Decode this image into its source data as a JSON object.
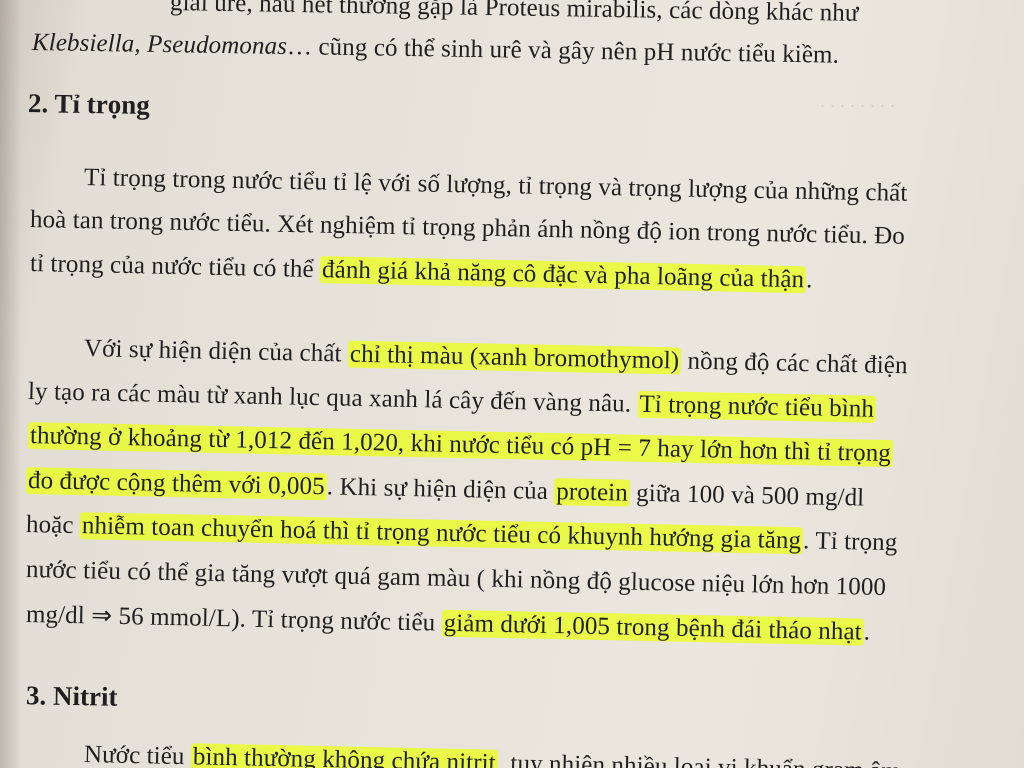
{
  "page": {
    "intro_line1": "giải urê, hầu hết thường gặp là Proteus mirabilis, các dòng khác như",
    "intro_line2_a": "Klebsiella, Pseudomonas",
    "intro_line2_b": "… cũng có thể sinh urê và gây nên pH nước tiểu kiềm.",
    "section2_heading": "2. Tỉ trọng",
    "p1": {
      "l1": "Tỉ trọng trong nước tiểu tỉ lệ với số lượng, tỉ trọng và trọng lượng của những chất",
      "l2": "hoà tan trong nước tiểu. Xét nghiệm tỉ trọng phản ánh nồng độ ion trong nước tiểu. Đo",
      "l3_a": "tỉ trọng của nước tiểu có thể ",
      "l3_hl": "đánh giá khả năng cô đặc và pha loãng của thận",
      "l3_b": "."
    },
    "p2": {
      "l1_a": "Với sự hiện diện của chất ",
      "l1_hl": "chỉ thị màu (xanh bromothymol)",
      "l1_b": " nồng độ các chất điện",
      "l2_a": "ly tạo ra các màu từ xanh lục qua xanh lá cây đến vàng nâu. ",
      "l2_hl": "Tỉ trọng nước tiểu bình",
      "l3_hl": "thường ở khoảng từ 1,012 đến 1,020, khi nước tiểu có pH = 7 hay lớn hơn thì tỉ trọng",
      "l4_hl": "đo được cộng thêm với 0,005",
      "l4_a": ". Khi sự hiện diện của ",
      "l4_hl2": "protein",
      "l4_b": " giữa 100 và 500 mg/dl",
      "l5_a": "hoặc ",
      "l5_hl": "nhiễm toan chuyển hoá thì tỉ trọng nước tiểu có khuynh hướng gia tăng",
      "l5_b": ". Tỉ trọng",
      "l6": "nước tiểu có thể gia tăng vượt quá gam màu ( khi nồng độ glucose niệu lớn hơn 1000",
      "l7_a": "mg/dl ⇒ 56 mmol/L). Tỉ trọng nước tiểu ",
      "l7_hl": "giảm dưới 1,005 trong bệnh đái tháo nhạt",
      "l7_b": "."
    },
    "section3_heading": "3. Nitrit",
    "p3": {
      "l1_a": "Nước tiểu ",
      "l1_hl": "bình thường không chứa nitrit",
      "l1_b": ", tuy nhiên nhiều loại vi khuẩn gram âm"
    }
  },
  "colors": {
    "paper": "#e7e3db",
    "ink": "#1f1f1f",
    "highlighter": "#ebff1e"
  }
}
